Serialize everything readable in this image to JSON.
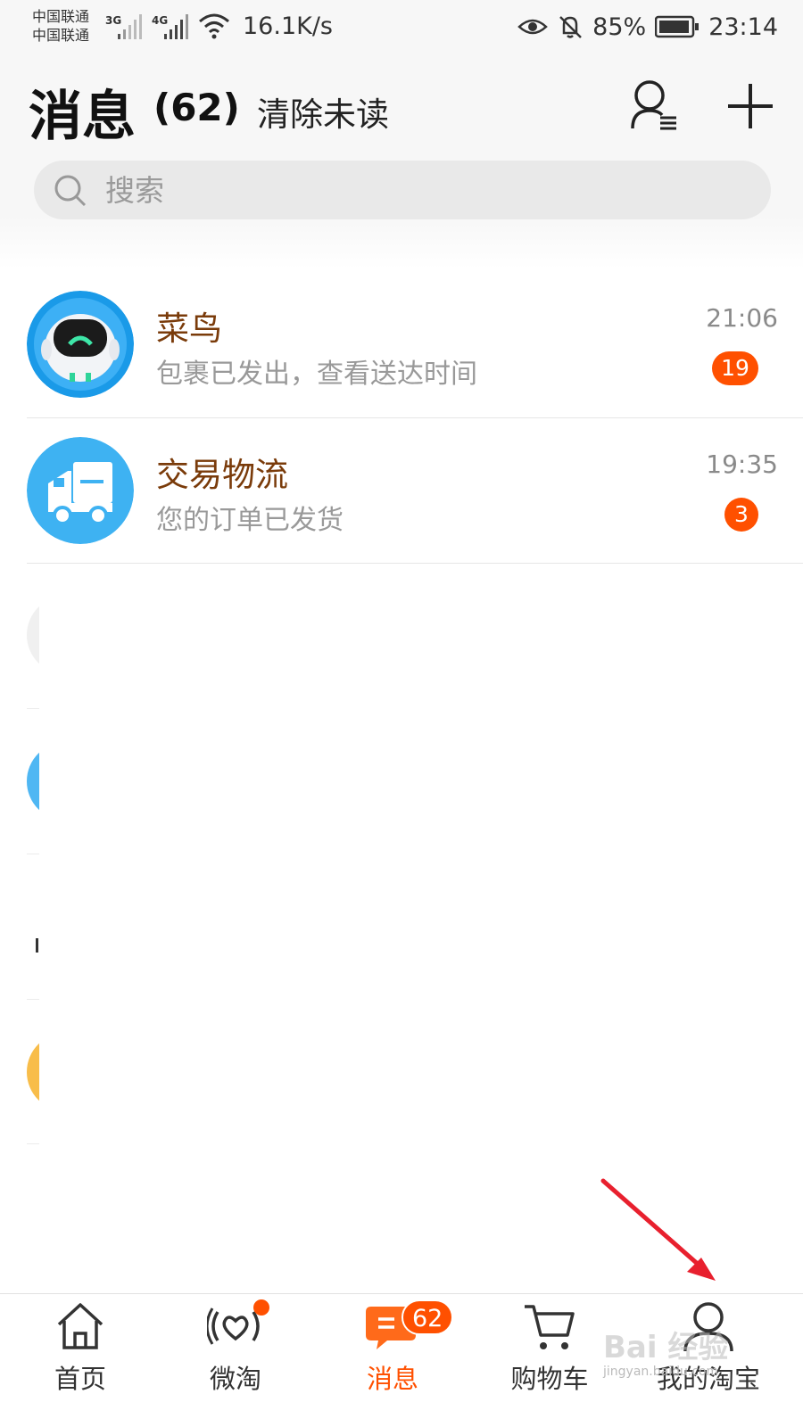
{
  "status_bar": {
    "carrier_1": "中国联通",
    "carrier_2": "中国联通",
    "network_1": "3G",
    "network_2": "4G",
    "net_speed": "16.1K/s",
    "battery": "85%",
    "time": "23:14",
    "icons": [
      "signal-icon",
      "wifi-icon",
      "eye-icon",
      "bell-muted-icon",
      "battery-icon"
    ]
  },
  "header": {
    "title": "消息",
    "count": "(62)",
    "clear_unread": "清除未读",
    "icons": [
      "contacts-icon",
      "plus-icon"
    ]
  },
  "search": {
    "placeholder": "搜索"
  },
  "conversations": [
    {
      "name": "菜鸟",
      "preview": "包裹已发出，查看送达时间",
      "time": "21:06",
      "unread": "19",
      "avatar": "cainiao-robot-avatar"
    },
    {
      "name": "交易物流",
      "preview": "您的订单已发货",
      "time": "19:35",
      "unread": "3",
      "avatar": "truck-avatar"
    }
  ],
  "tab_bar": {
    "tabs": [
      {
        "label": "首页",
        "icon": "home-icon"
      },
      {
        "label": "微淘",
        "icon": "weitao-icon",
        "dot": true
      },
      {
        "label": "消息",
        "icon": "message-icon",
        "badge": "62",
        "active": true
      },
      {
        "label": "购物车",
        "icon": "cart-icon"
      },
      {
        "label": "我的淘宝",
        "icon": "profile-icon"
      }
    ]
  },
  "colors": {
    "accent": "#ff5000",
    "name_text": "#7a3b0a",
    "header_bg": "#f7f7f7",
    "annotation_arrow": "#e8202e"
  },
  "watermark": {
    "text": "Bai 经验",
    "url_text": "jingyan.baidu.com"
  }
}
